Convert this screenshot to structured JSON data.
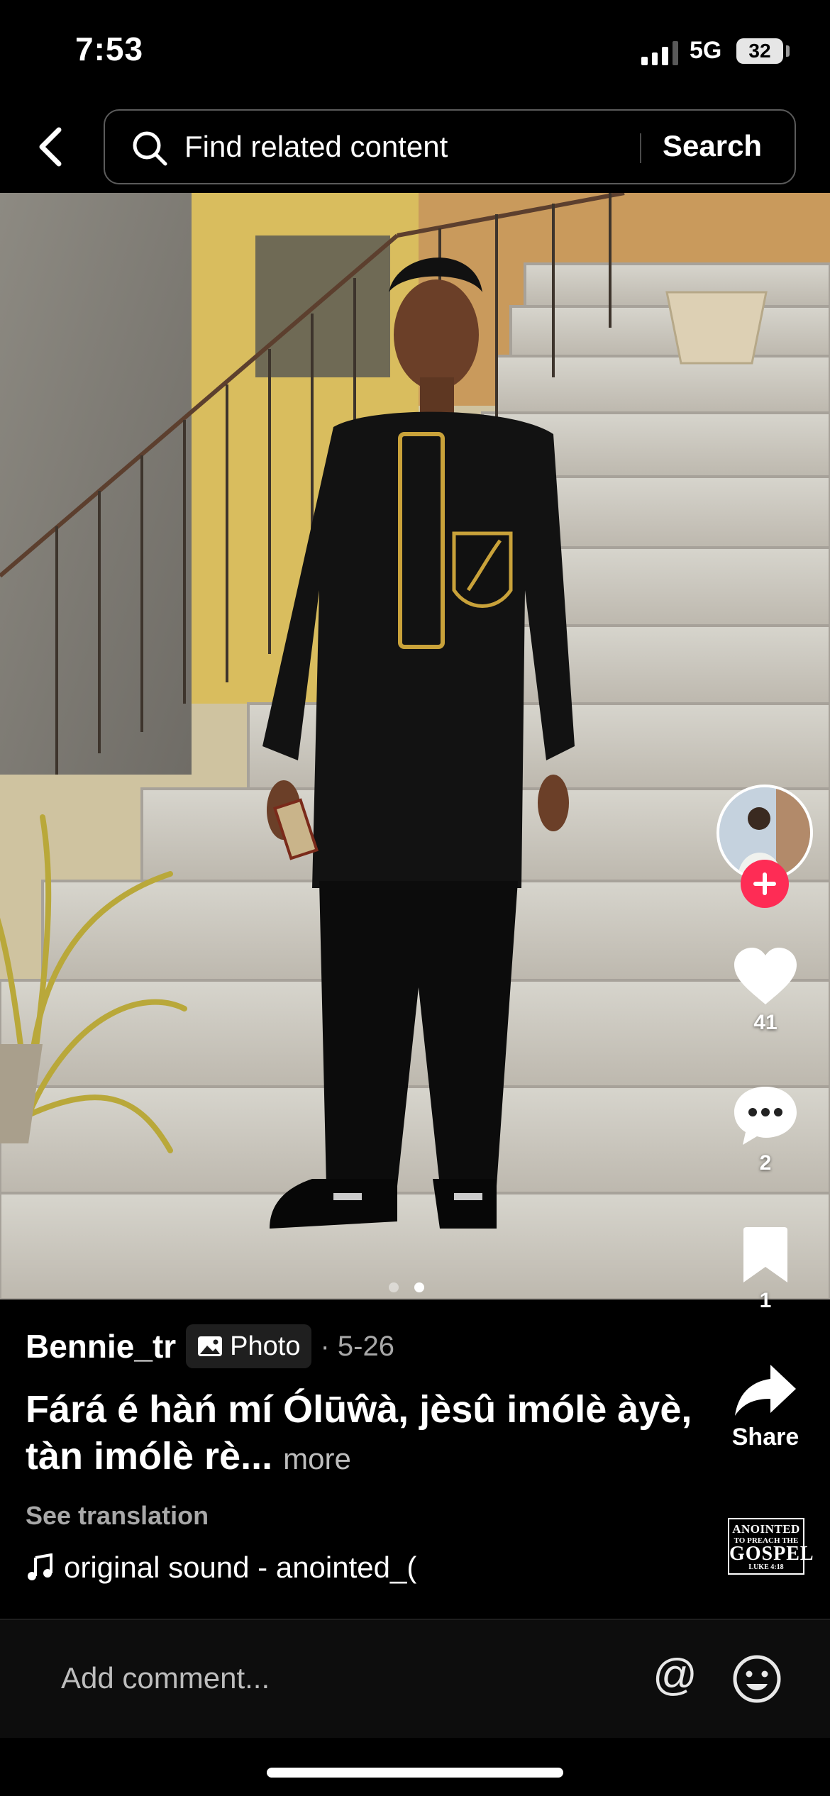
{
  "status": {
    "time": "7:53",
    "network": "5G",
    "battery": "32"
  },
  "search": {
    "placeholder": "Find related content",
    "button": "Search"
  },
  "post": {
    "author": "Bennie_tr",
    "type_label": "Photo",
    "date": "· 5-26",
    "caption": "Fárá é hàń mí Ólūŵà, jèsû imólè àyè, tàn imólè rè...",
    "more": "more",
    "see_translation": "See translation",
    "sound": "original sound - anointed_(",
    "photo_pages": 2,
    "active_page": 2
  },
  "actions": {
    "likes": "41",
    "comments": "2",
    "saves": "1",
    "share": "Share"
  },
  "sound_disc": {
    "line1": "ANOINTED",
    "line2": "TO PREACH THE",
    "line3": "GOSPEL",
    "line4": "LUKE 4:18"
  },
  "comment": {
    "placeholder": "Add comment..."
  },
  "icons": [
    "back-chevron-icon",
    "search-icon",
    "photo-icon",
    "heart-icon",
    "comment-icon",
    "bookmark-icon",
    "share-icon",
    "music-note-icon",
    "at-icon",
    "emoji-icon",
    "plus-icon"
  ],
  "colors": {
    "follow": "#fe2c55",
    "background": "#000000"
  }
}
